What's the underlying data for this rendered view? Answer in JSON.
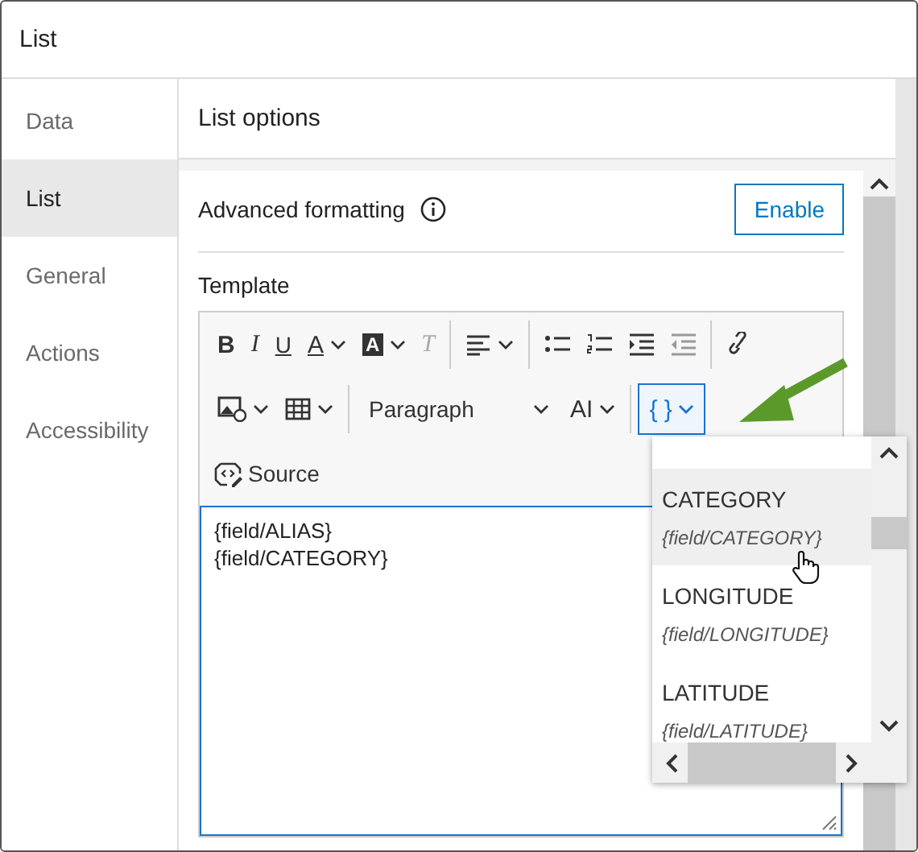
{
  "window": {
    "title": "List"
  },
  "sidebar": {
    "items": [
      {
        "label": "Data",
        "selected": false
      },
      {
        "label": "List",
        "selected": true
      },
      {
        "label": "General",
        "selected": false
      },
      {
        "label": "Actions",
        "selected": false
      },
      {
        "label": "Accessibility",
        "selected": false
      }
    ]
  },
  "panel": {
    "title": "List options",
    "advanced_formatting": {
      "label": "Advanced formatting",
      "button": "Enable"
    },
    "template": {
      "label": "Template",
      "toolbar": {
        "row_1": [
          {
            "kind": "bold",
            "glyph": "B",
            "caret": false
          },
          {
            "kind": "italic",
            "glyph": "I",
            "caret": false
          },
          {
            "kind": "underline",
            "glyph": "U",
            "caret": false
          },
          {
            "kind": "font-color",
            "glyph": "A",
            "caret": true
          },
          {
            "kind": "highlight",
            "glyph": "A",
            "caret": true
          },
          {
            "kind": "clear-format",
            "glyph": "T",
            "caret": false
          },
          {
            "kind": "divider"
          },
          {
            "kind": "align",
            "caret": true
          },
          {
            "kind": "divider"
          },
          {
            "kind": "bullets",
            "caret": false
          },
          {
            "kind": "numbers",
            "caret": false
          },
          {
            "kind": "indent",
            "caret": false
          },
          {
            "kind": "outdent",
            "caret": false
          },
          {
            "kind": "divider"
          },
          {
            "kind": "link",
            "caret": false
          }
        ],
        "row_2": [
          {
            "kind": "image",
            "caret": true
          },
          {
            "kind": "table",
            "caret": true
          },
          {
            "kind": "divider"
          },
          {
            "kind": "format-select",
            "label": "Paragraph",
            "caret": true
          },
          {
            "kind": "font-size",
            "glyph": "AI",
            "caret": true
          },
          {
            "kind": "divider"
          },
          {
            "kind": "field-insert",
            "glyph": "{ }",
            "caret": true,
            "selected": true
          }
        ],
        "source_button": "Source"
      },
      "content": [
        "{field/ALIAS}",
        "{field/CATEGORY}"
      ],
      "field_menu": {
        "items": [
          {
            "name": "CATEGORY",
            "token": "{field/CATEGORY}",
            "hovered": true
          },
          {
            "name": "LONGITUDE",
            "token": "{field/LONGITUDE}",
            "hovered": false
          },
          {
            "name": "LATITUDE",
            "token": "{field/LATITUDE}",
            "hovered": false
          }
        ]
      }
    }
  }
}
